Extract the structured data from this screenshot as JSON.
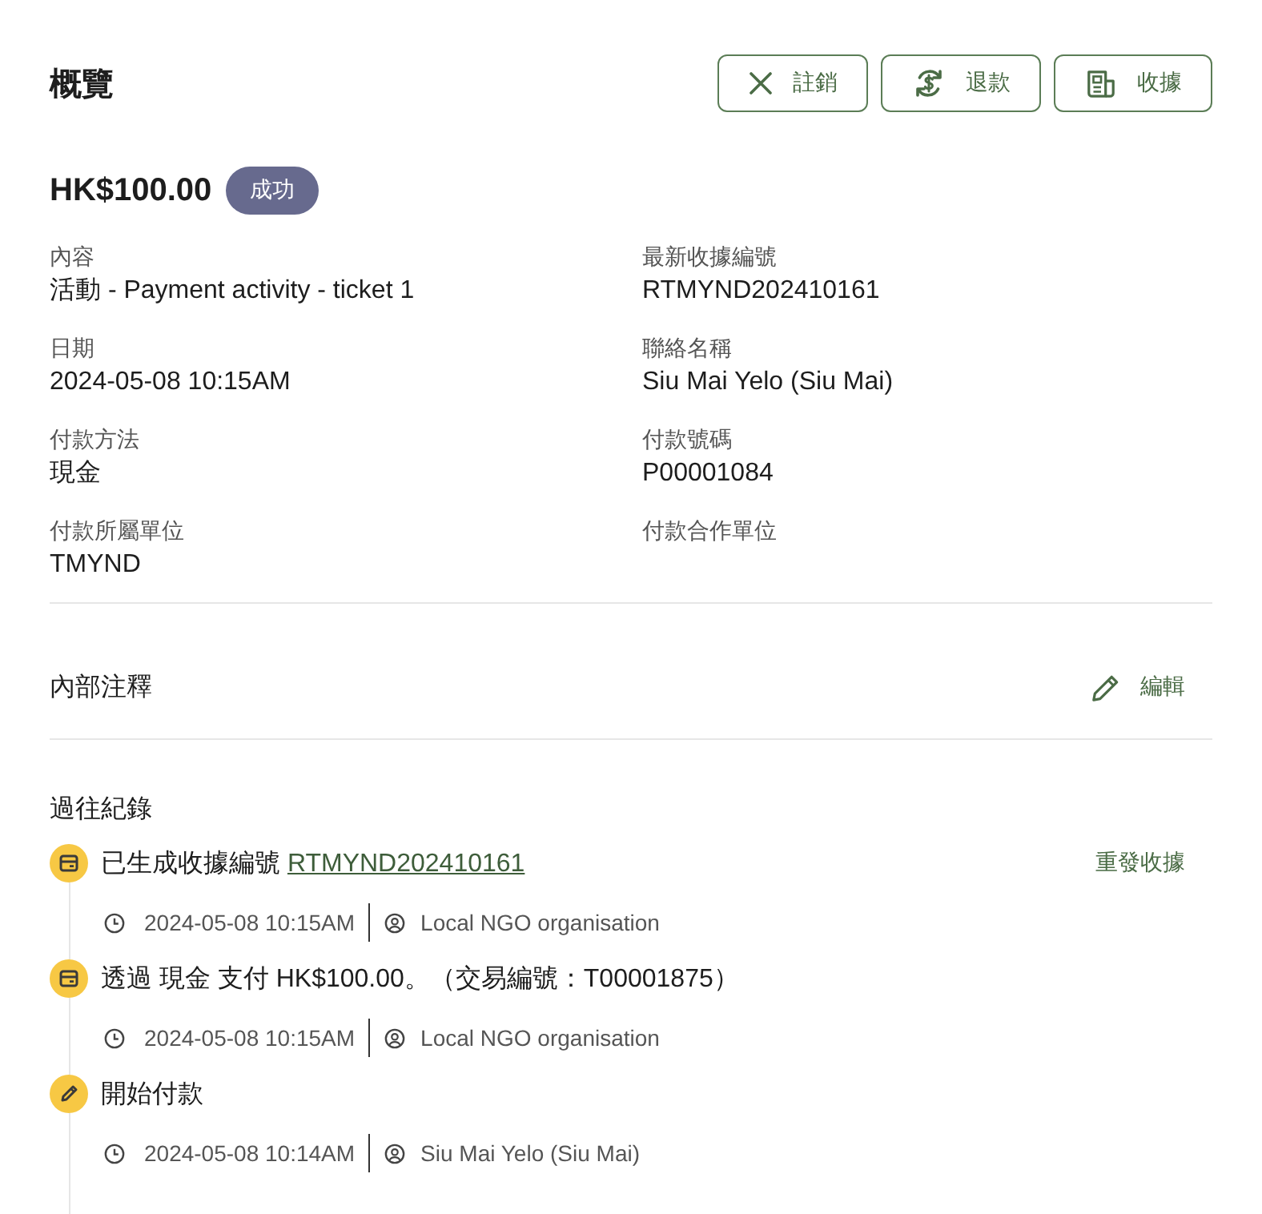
{
  "header": {
    "title": "概覽",
    "buttons": [
      {
        "kind": "void",
        "label": "註銷"
      },
      {
        "kind": "refund",
        "label": "退款"
      },
      {
        "kind": "receipt",
        "label": "收據"
      }
    ]
  },
  "summary": {
    "amount": "HK$100.00",
    "status": "成功"
  },
  "details": [
    {
      "label": "內容",
      "value": "活動 - Payment activity - ticket 1"
    },
    {
      "label": "最新收據編號",
      "value": "RTMYND202410161"
    },
    {
      "label": "日期",
      "value": "2024-05-08 10:15AM"
    },
    {
      "label": "聯絡名稱",
      "value": "Siu Mai Yelo (Siu Mai)"
    },
    {
      "label": "付款方法",
      "value": "現金"
    },
    {
      "label": "付款號碼",
      "value": "P00001084"
    },
    {
      "label": "付款所屬單位",
      "value": "TMYND"
    },
    {
      "label": "付款合作單位"
    }
  ],
  "notes": {
    "title": "內部注釋",
    "edit": "編輯"
  },
  "history": {
    "title": "過往紀錄",
    "events": [
      {
        "kind": "receipt",
        "text": "已生成收據編號",
        "link": "RTMYND202410161",
        "action": "重發收據",
        "time": "2024-05-08 10:15AM",
        "actor": "Local NGO organisation"
      },
      {
        "kind": "receipt",
        "text": "透過 現金 支付 HK$100.00。（交易編號：T00001875）",
        "time": "2024-05-08 10:15AM",
        "actor": "Local NGO organisation"
      },
      {
        "kind": "edit",
        "text": "開始付款",
        "time": "2024-05-08 10:14AM",
        "actor": "Siu Mai Yelo (Siu Mai)"
      }
    ]
  }
}
